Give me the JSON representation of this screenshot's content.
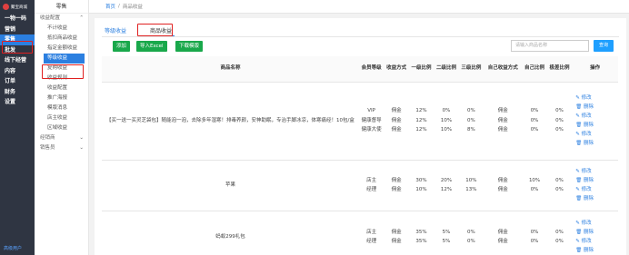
{
  "app": {
    "logo_text": "聚宝商城"
  },
  "nav1": {
    "items": [
      {
        "label": "一物一码"
      },
      {
        "label": "营销"
      },
      {
        "label": "零售"
      },
      {
        "label": "批发"
      },
      {
        "label": "线下经营"
      },
      {
        "label": "内容"
      },
      {
        "label": "订单"
      },
      {
        "label": "财务"
      },
      {
        "label": "设置"
      }
    ],
    "footer": "高级用户"
  },
  "nav2": {
    "head": "零售",
    "group1": "收益配置",
    "items": [
      "不计收益",
      "抵扣商品收益",
      "指定金额收益",
      "等级收益",
      "复购收益",
      "收益规则",
      "收益配置",
      "推广海报",
      "模版消息",
      "店主收益",
      "区域收益"
    ],
    "group2": "经销商",
    "group3": "销售员"
  },
  "breadcrumb": {
    "home": "首页",
    "sep": "/",
    "current": "商品收益"
  },
  "tabs": [
    "等级收益",
    "商品收益"
  ],
  "toolbar": {
    "add": "添加",
    "import": "导入Excel",
    "download": "下载模版"
  },
  "search": {
    "placeholder": "请输入商品名称",
    "button": "查询"
  },
  "table": {
    "headers": [
      "商品名称",
      "会员等级",
      "收益方式",
      "一级比例",
      "二级比例",
      "三级比例",
      "自己收益方式",
      "自己比例",
      "极差比例",
      "操作"
    ],
    "rows": [
      {
        "name": "【买一送一买灵芝袋包】随能泡一泡，去除多年湿寒！排毒养颜，安神助眠，专治手脚冰凉，体寒痛经！10包/盒",
        "levels": [
          "VIP",
          "健康督导",
          "健康大使"
        ],
        "method": [
          "佣金",
          "佣金",
          "佣金"
        ],
        "l1": [
          "12%",
          "12%",
          "12%"
        ],
        "l2": [
          "0%",
          "10%",
          "10%"
        ],
        "l3": [
          "0%",
          "0%",
          "8%"
        ],
        "self_method": [
          "佣金",
          "佣金",
          "佣金"
        ],
        "self": [
          "0%",
          "0%",
          "0%"
        ],
        "diff": [
          "0%",
          "0%",
          "0%"
        ]
      },
      {
        "name": "苹果",
        "levels": [
          "店主",
          "经理"
        ],
        "method": [
          "佣金",
          "佣金"
        ],
        "l1": [
          "30%",
          "10%"
        ],
        "l2": [
          "20%",
          "12%"
        ],
        "l3": [
          "10%",
          "13%"
        ],
        "self_method": [
          "佣金",
          "佣金"
        ],
        "self": [
          "10%",
          "0%"
        ],
        "diff": [
          "0%",
          "0%"
        ]
      },
      {
        "name": "蚂蚁299礼包",
        "levels": [
          "店主",
          "经理"
        ],
        "method": [
          "佣金",
          "佣金"
        ],
        "l1": [
          "35%",
          "35%"
        ],
        "l2": [
          "5%",
          "5%"
        ],
        "l3": [
          "0%",
          "0%"
        ],
        "self_method": [
          "佣金",
          "佣金"
        ],
        "self": [
          "0%",
          "0%"
        ],
        "diff": [
          "0%",
          "0%"
        ]
      }
    ],
    "op_edit": "✎ 修改",
    "op_delete": "🗑 删除"
  }
}
